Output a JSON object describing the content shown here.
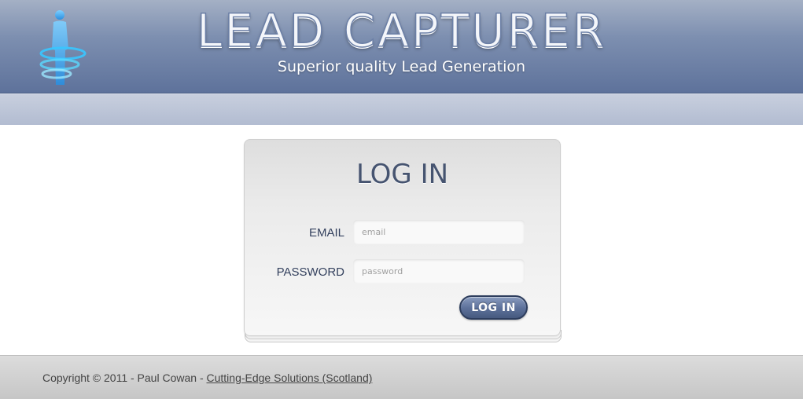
{
  "header": {
    "title": "LEAD CAPTURER",
    "tagline": "Superior quality Lead Generation"
  },
  "login": {
    "heading": "LOG IN",
    "email_label": "EMAIL",
    "email_placeholder": "email",
    "password_label": "PASSWORD",
    "password_placeholder": "password",
    "button_label": "LOG IN"
  },
  "footer": {
    "copyright_text": "Copyright © 2011 - Paul Cowan - ",
    "link_text": "Cutting-Edge Solutions (Scotland)"
  },
  "colors": {
    "header_blue": "#5e729b",
    "button_dark": "#2e3e5e",
    "heading_text": "#465470"
  }
}
